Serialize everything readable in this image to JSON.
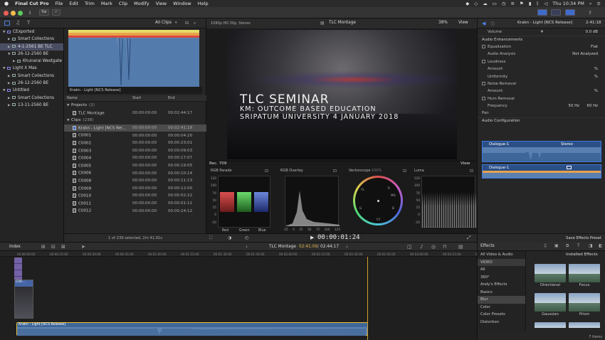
{
  "menubar": {
    "apple": "",
    "app": "Final Cut Pro",
    "menus": [
      "File",
      "Edit",
      "Trim",
      "Mark",
      "Clip",
      "Modify",
      "View",
      "Window",
      "Help"
    ],
    "clock": "Thu 10:34 PM"
  },
  "toolbar": {
    "keyword_btn": "0w"
  },
  "library": {
    "items": [
      {
        "label": "CExported",
        "level": 0,
        "type": "library",
        "open": true
      },
      {
        "label": "Smart Collections",
        "level": 1,
        "type": "folder",
        "open": false
      },
      {
        "label": "4-1-2561 BE TLC",
        "level": 1,
        "type": "event",
        "open": false,
        "selected": true
      },
      {
        "label": "26-12-2560 BE",
        "level": 1,
        "type": "event",
        "open": true
      },
      {
        "label": "Khunarai Westgate",
        "level": 2,
        "type": "keyword",
        "open": false
      },
      {
        "label": "Light X Mas",
        "level": 0,
        "type": "library",
        "open": true
      },
      {
        "label": "Smart Collections",
        "level": 1,
        "type": "folder",
        "open": false
      },
      {
        "label": "26-12-2560 BE",
        "level": 1,
        "type": "event",
        "open": false
      },
      {
        "label": "Untitled",
        "level": 0,
        "type": "library",
        "open": true
      },
      {
        "label": "Smart Collections",
        "level": 1,
        "type": "folder",
        "open": false
      },
      {
        "label": "13-11-2560 BE",
        "level": 1,
        "type": "event",
        "open": false
      }
    ]
  },
  "browser": {
    "filter": "All Clips",
    "filmstrip_label": "Krakn - Light [NCS Release]",
    "columns": [
      "Name",
      "Start",
      "End"
    ],
    "rows": [
      {
        "name": "Projects",
        "count": "(1)",
        "group": true
      },
      {
        "name": "TLC Montage",
        "start": "00:00:00:00",
        "end": "00:02:44:17",
        "kind": "project"
      },
      {
        "name": "Clips",
        "count": "(238)",
        "group": true
      },
      {
        "name": "Krakn - Light [NCS Rel...",
        "start": "00:00:00:00",
        "end": "00:02:41:18",
        "kind": "audio",
        "selected": true
      },
      {
        "name": "C0001",
        "start": "00:00:00:00",
        "end": "00:00:04:20",
        "kind": "video"
      },
      {
        "name": "C0002",
        "start": "00:00:00:00",
        "end": "00:00:23:01",
        "kind": "video"
      },
      {
        "name": "C0003",
        "start": "00:00:00:00",
        "end": "00:00:09:03",
        "kind": "video"
      },
      {
        "name": "C0004",
        "start": "00:00:00:00",
        "end": "00:00:17:07",
        "kind": "video"
      },
      {
        "name": "C0005",
        "start": "00:00:00:00",
        "end": "00:00:19:05",
        "kind": "video"
      },
      {
        "name": "C0006",
        "start": "00:00:00:00",
        "end": "00:00:10:14",
        "kind": "video"
      },
      {
        "name": "C0008",
        "start": "00:00:00:00",
        "end": "00:00:11:13",
        "kind": "video"
      },
      {
        "name": "C0009",
        "start": "00:00:00:00",
        "end": "00:00:12:00",
        "kind": "video"
      },
      {
        "name": "C0010",
        "start": "00:00:00:00",
        "end": "00:00:02:22",
        "kind": "video"
      },
      {
        "name": "C0011",
        "start": "00:00:00:00",
        "end": "00:00:01:11",
        "kind": "video"
      },
      {
        "name": "C0012",
        "start": "00:00:00:00",
        "end": "00:00:24:12",
        "kind": "video"
      }
    ],
    "footer": "1 of 239 selected, 2m 41.91s"
  },
  "viewer": {
    "format": "1080p HD 30p, Stereo",
    "project": "TLC Montage",
    "zoom": "38%",
    "view_btn": "View",
    "title_lines": [
      "TLC SEMINAR",
      "KM: OUTCOME BASED EDUCATION",
      "SRIPATUM UNIVERSITY 4 JANUARY 2018"
    ]
  },
  "scopes": {
    "colorspace": "Rec. 709",
    "view_btn": "View",
    "rgb_parade": {
      "label": "RGB Parade",
      "scale": [
        "120",
        "100",
        "76",
        "50",
        "25",
        "0",
        "-20"
      ],
      "channels": [
        "Red",
        "Green",
        "Blue"
      ]
    },
    "rgb_overlay": {
      "label": "RGB Overlay",
      "xscale": [
        "-25",
        "0",
        "25",
        "50",
        "75",
        "100",
        "125"
      ]
    },
    "vectorscope": {
      "label": "Vectorscope",
      "pct": "100%",
      "marks": [
        "R",
        "MG",
        "B",
        "CY",
        "G",
        "YL"
      ]
    },
    "luma": {
      "label": "Luma",
      "scale": [
        "120",
        "100",
        "76",
        "50",
        "25",
        "0",
        "-20"
      ]
    },
    "timecode": "00:00:01:24"
  },
  "inspector": {
    "clip_name": "Krakn - Light [NCS Release]",
    "duration": "2:41:18",
    "volume_label": "Volume",
    "volume_value": "0.0 dB",
    "enhancements_label": "Audio Enhancements",
    "rows": [
      {
        "label": "Equalization",
        "value": "Flat",
        "check": true,
        "indent": 1
      },
      {
        "label": "Audio Analysis",
        "value": "Not Analyzed",
        "indent": 2
      },
      {
        "label": "Loudness",
        "check": true,
        "indent": 1
      },
      {
        "label": "Amount",
        "value": "%",
        "indent": 2
      },
      {
        "label": "Uniformity",
        "value": "%",
        "indent": 2
      },
      {
        "label": "Noise Removal",
        "check": true,
        "indent": 1
      },
      {
        "label": "Amount",
        "value": "%",
        "indent": 2
      },
      {
        "label": "Hum Removal",
        "check": true,
        "indent": 1
      },
      {
        "label": "Frequency",
        "value": "50 Hz",
        "value2": "60 Hz",
        "indent": 2
      },
      {
        "label": "Pan",
        "indent": 1
      }
    ],
    "audio_config_label": "Audio Configuration",
    "role1": "Dialogue-1",
    "role1_channel": "Stereo",
    "role2": "Dialogue-1",
    "save_preset": "Save Effects Preset"
  },
  "timeline": {
    "index_btn": "Index",
    "project": "TLC Montage",
    "position": "02:41:09",
    "total": "02:44:17",
    "ticks": [
      "00:00:00:00",
      "00:00:15:00",
      "00:00:30:00",
      "00:00:45:00",
      "00:01:00:00",
      "00:01:15:00",
      "00:01:30:00",
      "00:01:45:00",
      "00:02:00:00",
      "00:02:15:00",
      "00:02:30:00",
      "00:02:45:00",
      "00:03:00:00",
      "00:03:15:00",
      "00:03:30:00"
    ],
    "audio_clip": "Krakn - Light [NCS Release]",
    "video_clip": "C00..."
  },
  "effects": {
    "title": "Effects",
    "installed": "Installed Effects",
    "categories": [
      "All Video & Audio",
      "VIDEO",
      "All",
      "360°",
      "Andy's Effects",
      "Basics",
      "Blur",
      "Color",
      "Color Presets",
      "Distortion"
    ],
    "thumbs": [
      "Directional",
      "Focus",
      "Gaussian",
      "Prism"
    ],
    "count": "7 Items"
  },
  "colors": {
    "accent": "#3f6ccc",
    "audio_clip": "#5e84b3",
    "selection_yellow": "#e8c13a",
    "playhead": "#d4a12c"
  }
}
